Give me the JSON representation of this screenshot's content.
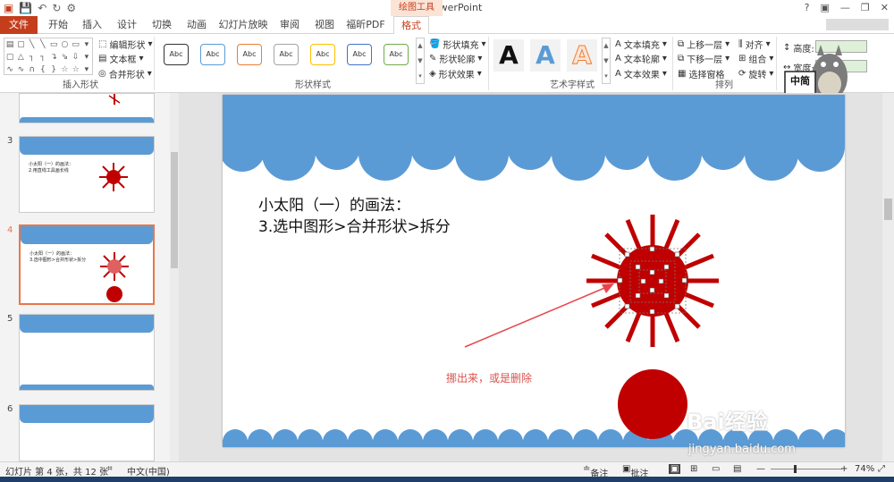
{
  "window": {
    "title": "1 - PowerPoint",
    "context_tab": "绘图工具",
    "controls": [
      "?",
      "▣",
      "—",
      "❐",
      "✕"
    ]
  },
  "tabs": [
    {
      "label": "文件",
      "active": false
    },
    {
      "label": "开始",
      "active": false
    },
    {
      "label": "插入",
      "active": false
    },
    {
      "label": "设计",
      "active": false
    },
    {
      "label": "切换",
      "active": false
    },
    {
      "label": "动画",
      "active": false
    },
    {
      "label": "幻灯片放映",
      "active": false
    },
    {
      "label": "审阅",
      "active": false
    },
    {
      "label": "视图",
      "active": false
    },
    {
      "label": "福昕PDF",
      "active": false
    },
    {
      "label": "格式",
      "active": true
    }
  ],
  "ribbon": {
    "insert_shapes": {
      "label": "插入形状",
      "edit_shape": "编辑形状",
      "text_box": "文本框",
      "merge_shapes": "合并形状"
    },
    "shape_styles": {
      "label": "形状样式",
      "samples": [
        "Abc",
        "Abc",
        "Abc",
        "Abc",
        "Abc",
        "Abc",
        "Abc"
      ],
      "sample_colors": [
        "#333333",
        "#5b9bd5",
        "#ed7d31",
        "#a5a5a5",
        "#ffc000",
        "#4472c4",
        "#70ad47"
      ],
      "fill": "形状填充",
      "outline": "形状轮廓",
      "effects": "形状效果"
    },
    "wordart": {
      "label": "艺术字样式",
      "samples": [
        "A",
        "A",
        "A"
      ],
      "text_fill": "文本填充",
      "text_outline": "文本轮廓",
      "text_effects": "文本效果"
    },
    "arrange": {
      "label": "排列",
      "bring_forward": "上移一层",
      "send_backward": "下移一层",
      "selection_pane": "选择窗格",
      "align": "对齐",
      "group": "组合",
      "rotate": "旋转"
    },
    "size": {
      "height": "高度:",
      "width": "宽度:"
    }
  },
  "sticker": {
    "text": "中简",
    "colors": {
      "body": "#7c7c7c",
      "belly": "#d9d3c4"
    }
  },
  "thumbnails": [
    {
      "num": "",
      "lines": []
    },
    {
      "num": "3",
      "lines": [
        "小太阳（一）的画法：",
        "2.用直线工具画长线"
      ]
    },
    {
      "num": "4",
      "lines": [
        "小太阳（一）的画法：",
        "3.选中图形>合并形状>拆分"
      ]
    },
    {
      "num": "5",
      "lines": []
    },
    {
      "num": "6",
      "lines": []
    }
  ],
  "slide": {
    "title_line1": "小太阳（一）的画法：",
    "title_line2": "3.选中图形>合并形状>拆分",
    "annotation": "挪出来，或是删除",
    "colors": {
      "cloud": "#5b9bd5",
      "sun": "#c00000",
      "arrow": "#e8434b"
    }
  },
  "status": {
    "slide_info": "幻灯片 第 4 张，共 12 张",
    "language": "中文(中国)",
    "notes": "备注",
    "comments": "批注",
    "zoom": "74%"
  },
  "watermark": {
    "text": "Bai经验",
    "url": "jingyan.baidu.com"
  }
}
